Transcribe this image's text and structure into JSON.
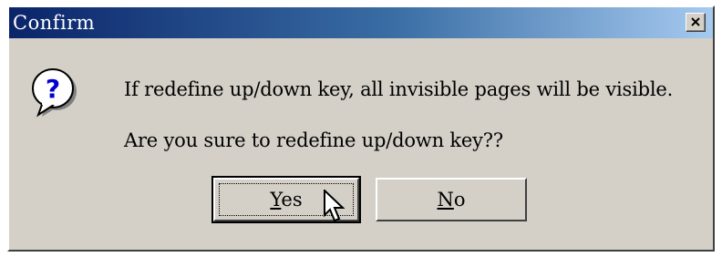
{
  "window": {
    "title": "Confirm",
    "close_glyph": "×"
  },
  "message": {
    "line1": "If redefine up/down key, all invisible pages will be visible.",
    "line2": "Are you sure to redefine up/down key??"
  },
  "buttons": {
    "yes": {
      "mnemonic": "Y",
      "rest": "es"
    },
    "no": {
      "mnemonic": "N",
      "rest": "o"
    }
  },
  "icons": {
    "dialog_icon": "question-icon",
    "close": "close-icon",
    "pointer": "mouse-cursor-icon"
  },
  "colors": {
    "titlebar_start": "#0a246a",
    "titlebar_end": "#a6caf0",
    "face": "#d4d0c8",
    "icon_blue": "#0000cc"
  }
}
